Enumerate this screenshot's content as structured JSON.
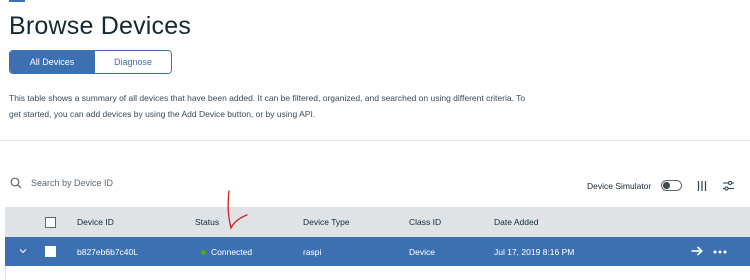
{
  "page": {
    "title": "Browse Devices",
    "description": "This table shows a summary of all devices that have been added. It can be filtered, organized, and searched on using different criteria. To get started, you can add devices by using the Add Device button, or by using API."
  },
  "tabs": [
    {
      "label": "All Devices",
      "active": true
    },
    {
      "label": "Diagnose",
      "active": false
    }
  ],
  "toolbar": {
    "search_placeholder": "Search by Device ID",
    "search_value": "",
    "simulator_label": "Device Simulator",
    "simulator_on": false
  },
  "table": {
    "headers": [
      "Device ID",
      "Status",
      "Device Type",
      "Class ID",
      "Date Added"
    ],
    "rows": [
      {
        "device_id": "b827eb6b7c40L",
        "status": "Connected",
        "device_type": "raspi",
        "class_id": "Device",
        "date_added": "Jul 17, 2019 8:16 PM",
        "selected": true
      }
    ]
  },
  "colors": {
    "accent": "#3d70b2",
    "status_connected": "#5aa700",
    "header_bg": "#dfe3e6",
    "annotation": "#d0201f"
  },
  "icons": {
    "search": "search-icon",
    "columns": "columns-icon",
    "settings": "sliders-icon",
    "expand": "chevron-down-icon",
    "navigate": "arrow-right-icon",
    "more": "overflow-menu-icon"
  }
}
